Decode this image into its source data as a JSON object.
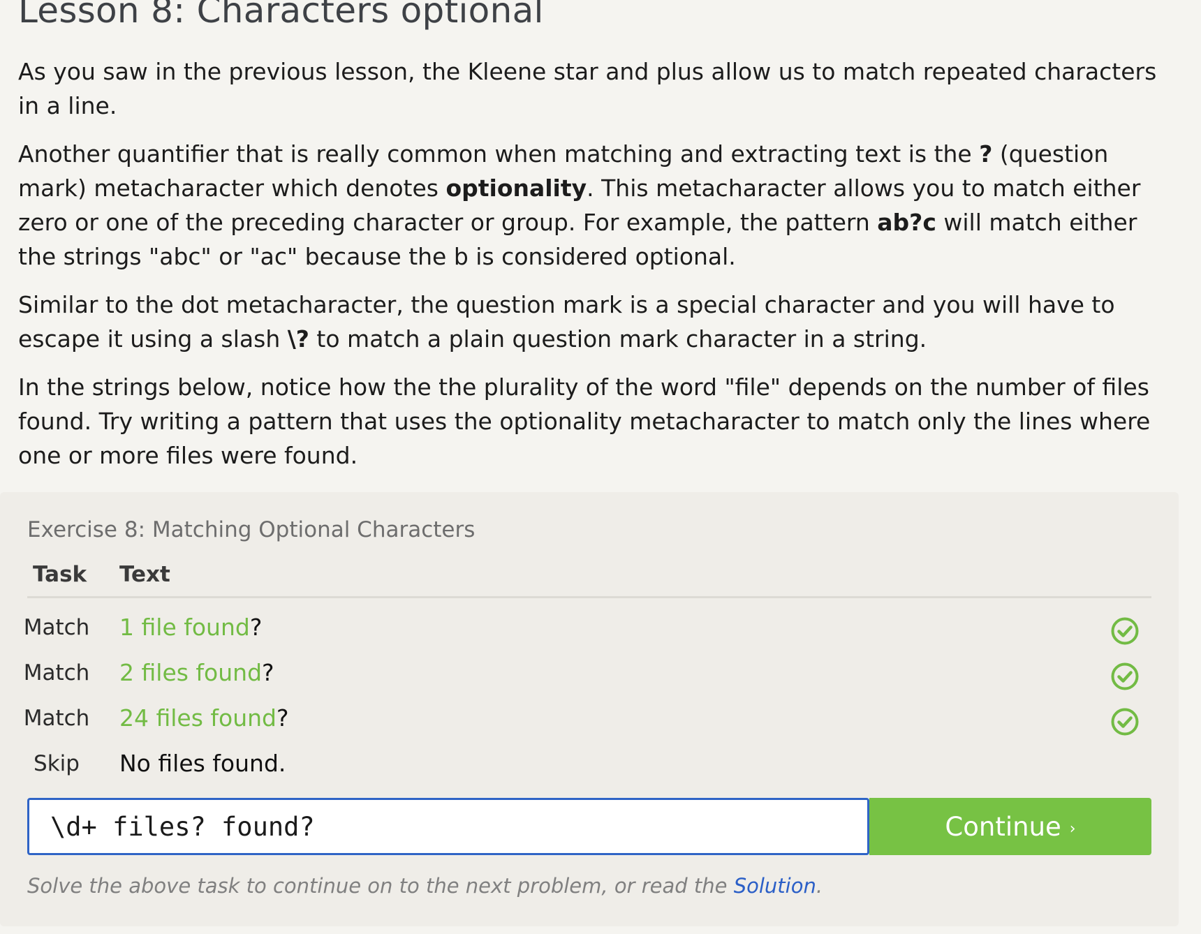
{
  "lesson": {
    "title": "Lesson 8: Characters optional",
    "para1": "As you saw in the previous lesson, the Kleene star and plus allow us to match repeated characters in a line.",
    "para2": {
      "t1": "Another quantifier that is really common when matching and extracting text is the ",
      "b1": "?",
      "t2": " (question mark) metacharacter which denotes ",
      "b2": "optionality",
      "t3": ". This metacharacter allows you to match either zero or one of the preceding character or group. For example, the pattern ",
      "b3": "ab?c",
      "t4": " will match either the strings \"abc\" or \"ac\" because the b is considered optional."
    },
    "para3": {
      "t1": "Similar to the dot metacharacter, the question mark is a special character and you will have to escape it using a slash ",
      "b1": "\\?",
      "t2": " to match a plain question mark character in a string."
    },
    "para4": "In the strings below, notice how the the plurality of the word \"file\" depends on the number of files found. Try writing a pattern that uses the optionality metacharacter to match only the lines where one or more files were found."
  },
  "exercise": {
    "title": "Exercise 8: Matching Optional Characters",
    "col_task": "Task",
    "col_text": "Text",
    "rows": [
      {
        "task": "Match",
        "highlight": "1 file found",
        "rest": "?",
        "status": "check-icon"
      },
      {
        "task": "Match",
        "highlight": "2 files found",
        "rest": "?",
        "status": "check-icon"
      },
      {
        "task": "Match",
        "highlight": "24 files found",
        "rest": "?",
        "status": "check-icon"
      },
      {
        "task": "Skip",
        "highlight": "",
        "rest": "No files found.",
        "status": ""
      }
    ],
    "input_value": "\\d+ files? found?",
    "continue_label": "Continue",
    "continue_chevron": "›",
    "hint_prefix": "Solve the above task to continue on to the next problem, or read the ",
    "solution_link": "Solution",
    "hint_suffix": ".",
    "colors": {
      "match_green": "#72bb44",
      "button_green": "#77c244",
      "input_border": "#2f64c6",
      "link_blue": "#2b5fc7"
    }
  }
}
